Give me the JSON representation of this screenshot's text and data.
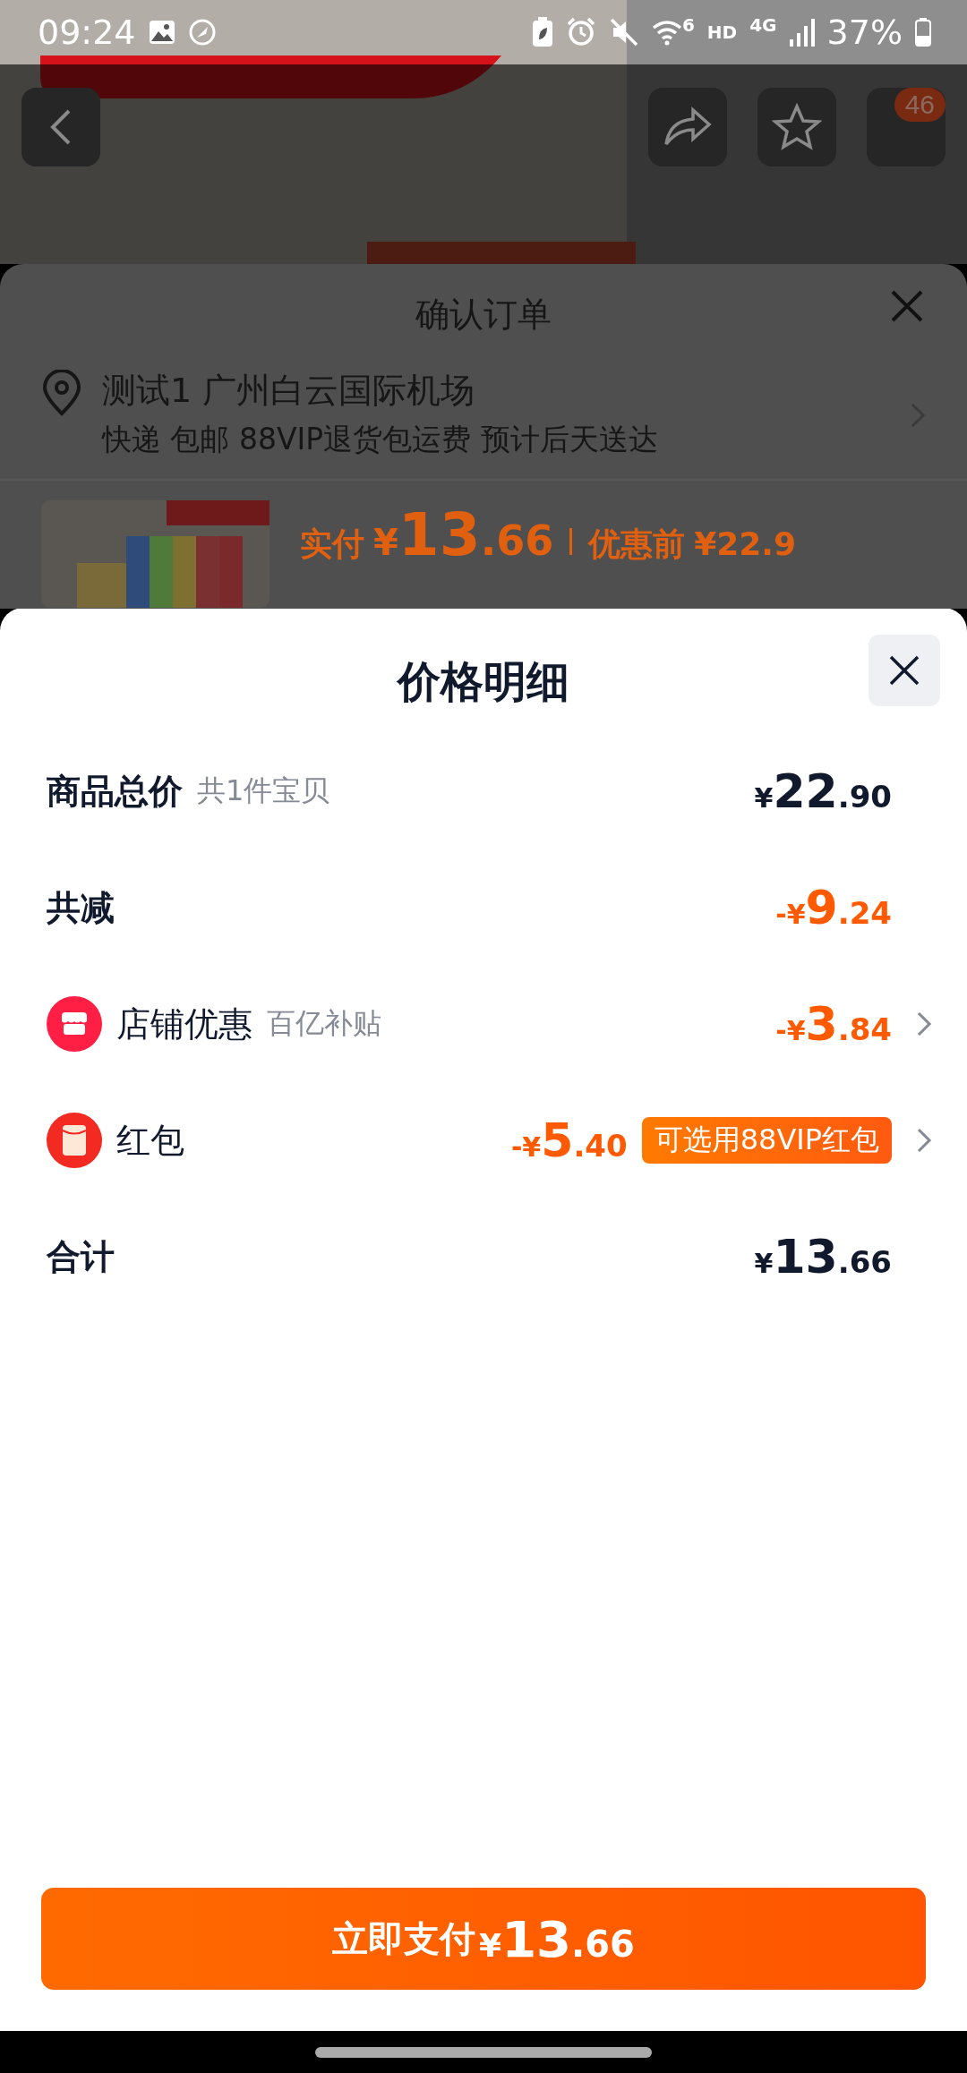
{
  "status_bar": {
    "time": "09:24",
    "wifi_label": "6",
    "network_labels": [
      "HD",
      "4G"
    ],
    "battery": "37%"
  },
  "nav": {
    "cart_badge": "46"
  },
  "order": {
    "title": "确认订单",
    "address": "测试1 广州白云国际机场",
    "delivery": "快递 包邮 88VIP退货包运费 预计后天送达",
    "paid_label": "实付",
    "paid_amount": "¥13.66",
    "before_label": "优惠前",
    "before_amount": "¥22.9"
  },
  "detail": {
    "title": "价格明细",
    "rows": [
      {
        "kind": "summary",
        "label": "商品总价",
        "note": "共1件宝贝",
        "amount": "¥22.90",
        "discount": false,
        "chevron": false
      },
      {
        "kind": "summary",
        "label": "共减",
        "amount": "-¥9.24",
        "discount": true,
        "chevron": false
      },
      {
        "kind": "store",
        "label": "店铺优惠",
        "note": "百亿补贴",
        "amount": "-¥3.84",
        "discount": true,
        "chevron": true
      },
      {
        "kind": "red_packet",
        "label": "红包",
        "amount": "-¥5.40",
        "badge": "可选用88VIP红包",
        "discount": true,
        "chevron": true
      },
      {
        "kind": "summary",
        "label": "合计",
        "amount": "¥13.66",
        "discount": false,
        "chevron": false
      }
    ]
  },
  "pay_button": {
    "label": "立即支付",
    "amount": "¥13.66"
  }
}
